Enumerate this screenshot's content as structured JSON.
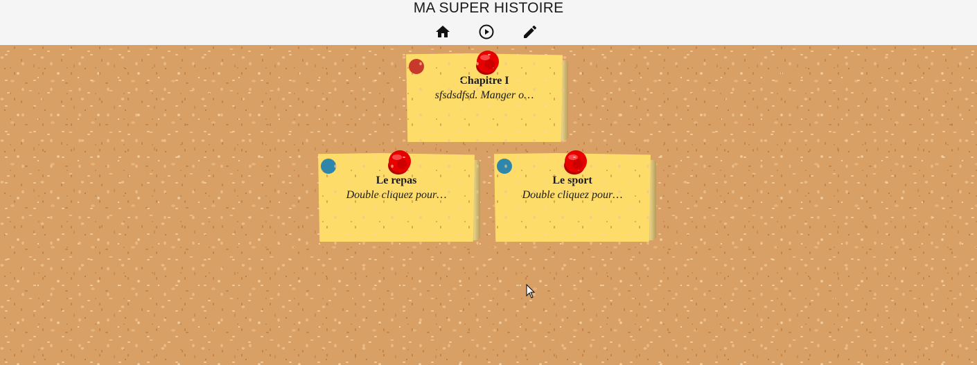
{
  "header": {
    "title": "MA SUPER HISTOIRE",
    "buttons": [
      {
        "name": "home",
        "icon": "home-icon"
      },
      {
        "name": "play",
        "icon": "play-circle-icon"
      },
      {
        "name": "edit",
        "icon": "pencil-icon"
      }
    ]
  },
  "notes": [
    {
      "title": "Chapitre I",
      "description": "sfsdsdfsd. Manger o…",
      "dot_color": "#c8392b",
      "pin_icon": "pushpin-icon"
    },
    {
      "title": "Le repas",
      "description": "Double cliquez pour…",
      "dot_color": "#2e86ab",
      "pin_icon": "pushpin-icon"
    },
    {
      "title": "Le sport",
      "description": "Double cliquez pour…",
      "dot_color": "#2e86ab",
      "pin_icon": "pushpin-icon"
    }
  ],
  "colors": {
    "note": "#fddc6a",
    "pin": "#e60000",
    "header_bg": "#f5f5f5",
    "board": "#d9a066"
  }
}
